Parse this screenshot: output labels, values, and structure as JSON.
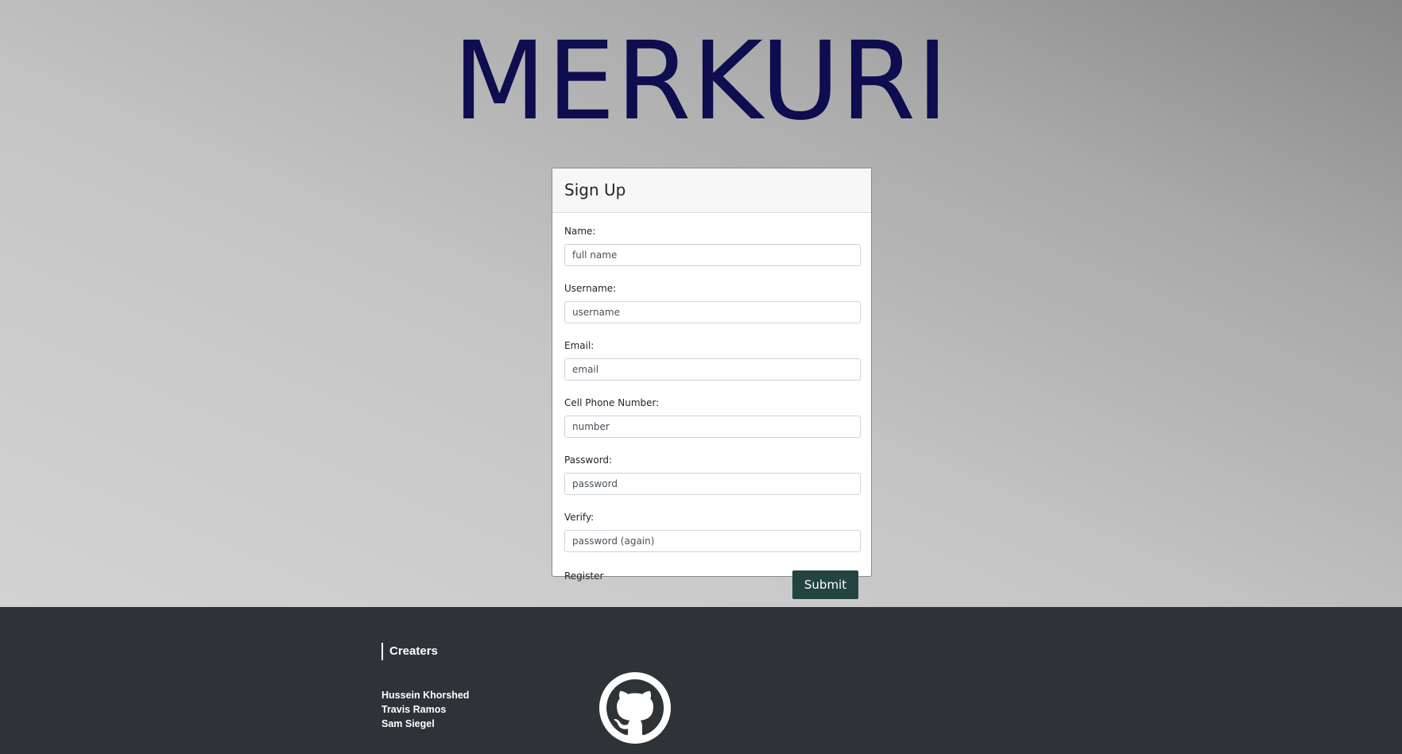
{
  "brand": {
    "title": "MERKURI"
  },
  "signup": {
    "title": "Sign Up",
    "fields": [
      {
        "label": "Name:",
        "placeholder": "full name"
      },
      {
        "label": "Username:",
        "placeholder": "username"
      },
      {
        "label": "Email:",
        "placeholder": "email"
      },
      {
        "label": "Cell Phone Number:",
        "placeholder": "number"
      },
      {
        "label": "Password:",
        "placeholder": "password"
      },
      {
        "label": "Verify:",
        "placeholder": "password (again)"
      }
    ],
    "register_text": "Register",
    "submit_label": "Submit"
  },
  "footer": {
    "heading": "Creaters",
    "creators": [
      "Hussein Khorshed",
      "Travis Ramos",
      "Sam Siegel"
    ],
    "github_icon": "github-icon"
  },
  "colors": {
    "brand_text": "#0d0d4f",
    "submit_button": "#234441",
    "footer_background": "#2e3338"
  }
}
